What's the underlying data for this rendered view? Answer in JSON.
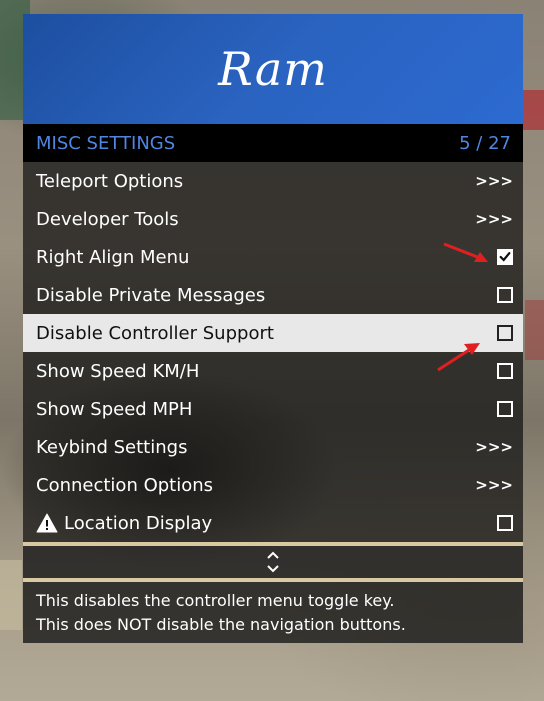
{
  "menu": {
    "title": "Ram",
    "section": "MISC SETTINGS",
    "position": "5 / 27",
    "items": [
      {
        "label": "Teleport Options",
        "type": "submenu",
        "indicator": ">>>"
      },
      {
        "label": "Developer Tools",
        "type": "submenu",
        "indicator": ">>>"
      },
      {
        "label": "Right Align Menu",
        "type": "checkbox",
        "checked": true
      },
      {
        "label": "Disable Private Messages",
        "type": "checkbox",
        "checked": false
      },
      {
        "label": "Disable Controller Support",
        "type": "checkbox",
        "checked": false,
        "selected": true
      },
      {
        "label": "Show Speed KM/H",
        "type": "checkbox",
        "checked": false
      },
      {
        "label": "Show Speed MPH",
        "type": "checkbox",
        "checked": false
      },
      {
        "label": "Keybind Settings",
        "type": "submenu",
        "indicator": ">>>"
      },
      {
        "label": "Connection Options",
        "type": "submenu",
        "indicator": ">>>"
      },
      {
        "label": "Location Display",
        "type": "checkbox",
        "checked": false,
        "icon": "warning-icon"
      }
    ],
    "description": [
      "This disables the controller menu toggle key.",
      "This does NOT disable the navigation buttons."
    ]
  },
  "colors": {
    "header": "#2a63c0",
    "section_text": "#4f86e0",
    "selected_bg": "#e8e8e8",
    "annotation_arrow": "#e02020"
  }
}
